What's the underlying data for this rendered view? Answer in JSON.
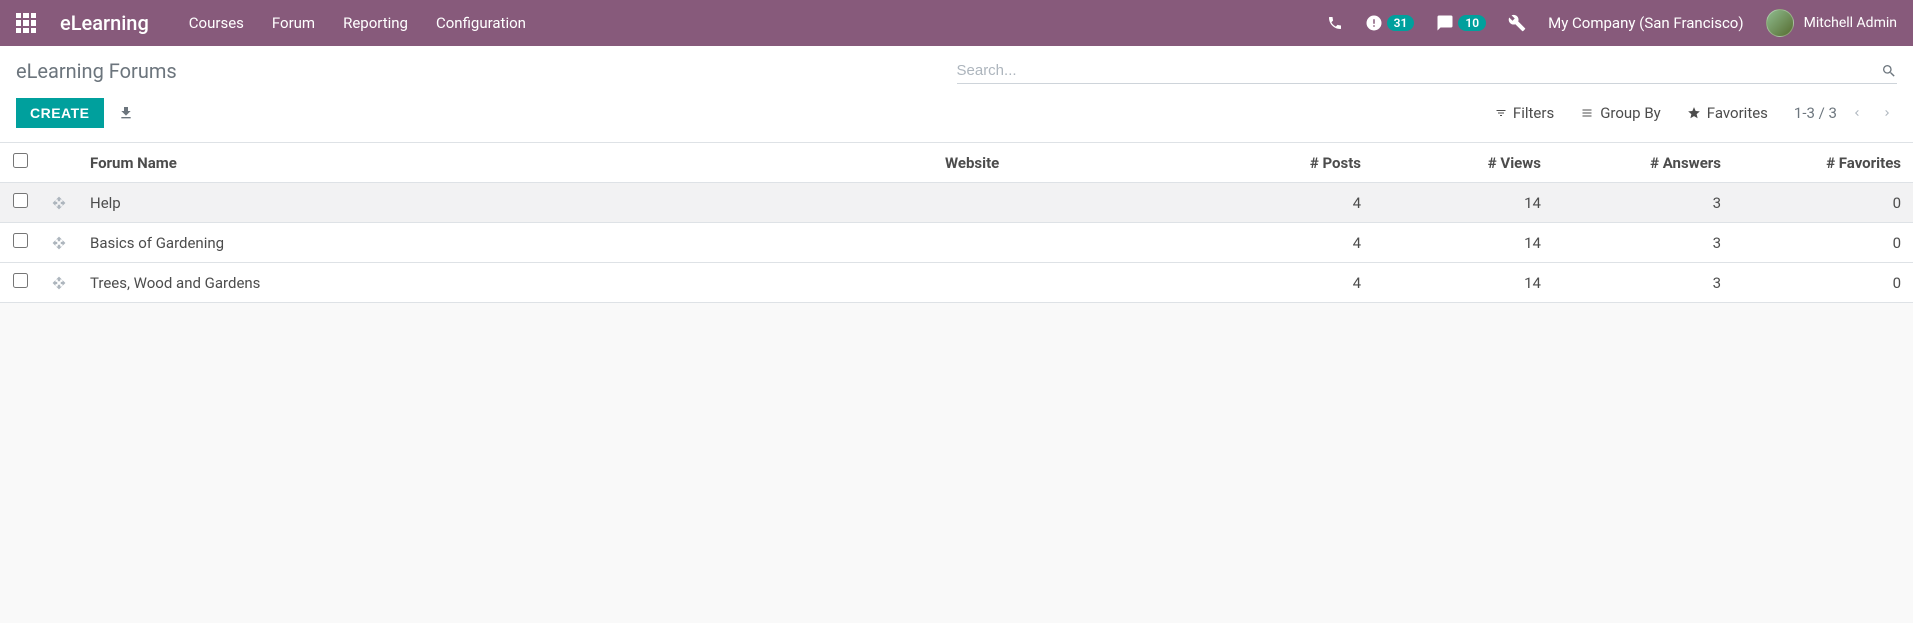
{
  "navbar": {
    "brand": "eLearning",
    "menu": [
      "Courses",
      "Forum",
      "Reporting",
      "Configuration"
    ],
    "badges": {
      "activities": "31",
      "messages": "10"
    },
    "company": "My Company (San Francisco)",
    "user": "Mitchell Admin"
  },
  "breadcrumb": "eLearning Forums",
  "search": {
    "placeholder": "Search..."
  },
  "buttons": {
    "create": "CREATE"
  },
  "filters": {
    "filters": "Filters",
    "group_by": "Group By",
    "favorites": "Favorites"
  },
  "pager": {
    "range": "1-3 / 3"
  },
  "table": {
    "headers": {
      "name": "Forum Name",
      "website": "Website",
      "posts": "# Posts",
      "views": "# Views",
      "answers": "# Answers",
      "favorites": "# Favorites"
    },
    "rows": [
      {
        "name": "Help",
        "website": "",
        "posts": "4",
        "views": "14",
        "answers": "3",
        "favorites": "0",
        "selected": true
      },
      {
        "name": "Basics of Gardening",
        "website": "",
        "posts": "4",
        "views": "14",
        "answers": "3",
        "favorites": "0",
        "selected": false
      },
      {
        "name": "Trees, Wood and Gardens",
        "website": "",
        "posts": "4",
        "views": "14",
        "answers": "3",
        "favorites": "0",
        "selected": false
      }
    ]
  }
}
